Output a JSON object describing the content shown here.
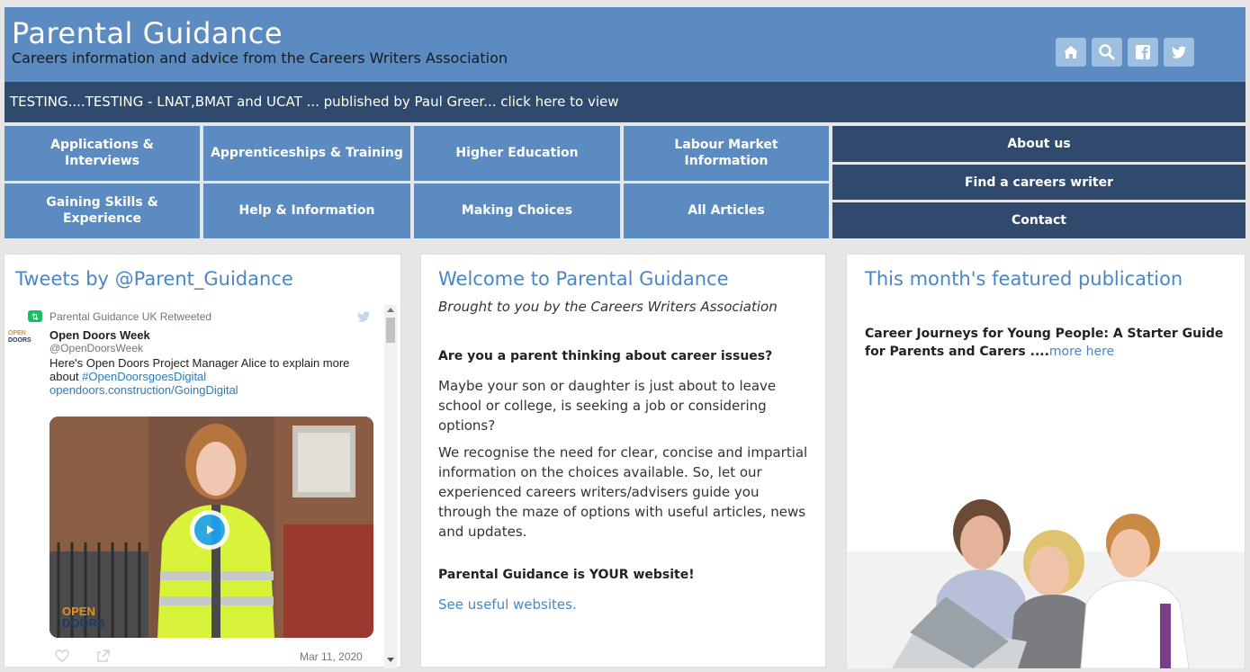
{
  "header": {
    "title": "Parental Guidance",
    "tagline": "Careers information and advice from the Careers Writers Association",
    "icons": [
      "home-icon",
      "search-icon",
      "facebook-icon",
      "twitter-icon"
    ]
  },
  "announcement": {
    "text": "TESTING....TESTING - LNAT,BMAT and UCAT ... published by Paul Greer... click here to view"
  },
  "nav": {
    "row1": [
      "Applications & Interviews",
      "Apprenticeships & Training",
      "Higher Education",
      "Labour Market Information"
    ],
    "row2": [
      "Gaining Skills & Experience",
      "Help & Information",
      "Making Choices",
      "All Articles"
    ],
    "right": [
      "About us",
      "Find a careers writer",
      "Contact"
    ]
  },
  "tweets": {
    "heading": "Tweets by @Parent_Guidance",
    "retweeted_by": "Parental Guidance UK Retweeted",
    "author_name": "Open Doors Week",
    "author_handle": "@OpenDoorsWeek",
    "avatar_text_top": "OPEN",
    "avatar_text_bottom": "DOORS",
    "body_prefix": "Here's Open Doors Project Manager Alice to explain more about ",
    "hashtag": "#OpenDoorsgoesDigital",
    "link": "opendoors.construction/GoingDigital",
    "video_logo_top": "OPEN",
    "video_logo_bottom": "DOORS",
    "date": "Mar 11, 2020"
  },
  "welcome": {
    "heading": "Welcome to Parental Guidance",
    "subtitle": "Brought to you by the Careers Writers Association",
    "question": "Are you a parent thinking about career issues?",
    "para1": "Maybe your son or daughter is just about to leave school or college, is seeking a job or considering options?",
    "para2": "We recognise the need for clear, concise and impartial information on the choices available.  So, let our experienced careers writers/advisers guide you through the maze of options with useful articles, news and updates.",
    "tagline": "Parental Guidance is YOUR website!",
    "link": "See useful websites."
  },
  "featured": {
    "heading": "This month's featured publication",
    "text": "Career Journeys for Young People: A Starter Guide for Parents and Carers ....",
    "link": "more here"
  },
  "colors": {
    "brand_blue": "#5b8bc0",
    "dark_navy": "#2f4a6c",
    "link_blue": "#4a86c5"
  }
}
